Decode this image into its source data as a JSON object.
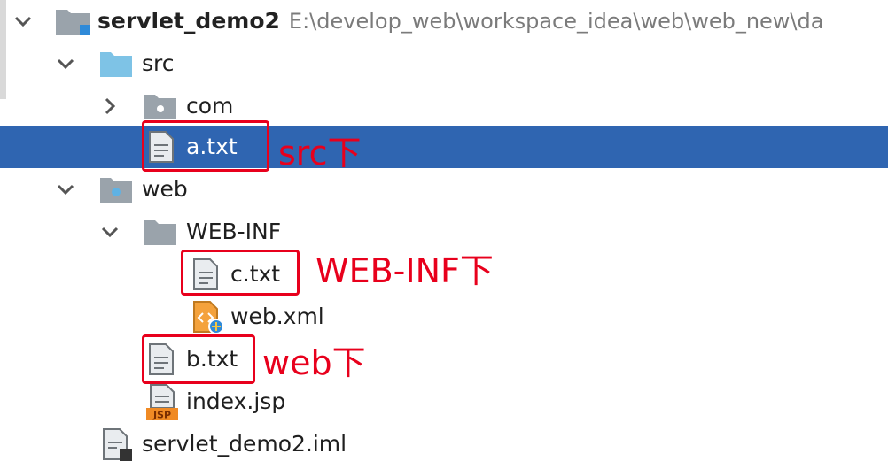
{
  "tree": {
    "root": {
      "name": "servlet_demo2",
      "path": "E:\\develop_web\\workspace_idea\\web\\web_new\\da"
    },
    "items": [
      {
        "label": "src"
      },
      {
        "label": "com"
      },
      {
        "label": "a.txt"
      },
      {
        "label": "web"
      },
      {
        "label": "WEB-INF"
      },
      {
        "label": "c.txt"
      },
      {
        "label": "web.xml"
      },
      {
        "label": "b.txt"
      },
      {
        "label": "index.jsp"
      },
      {
        "label": "servlet_demo2.iml"
      }
    ],
    "jsp_badge": "JSP"
  },
  "annotations": {
    "src": "src下",
    "webinf": "WEB-INF下",
    "web": "web下"
  },
  "colors": {
    "selection": "#2f65b1",
    "annotation": "#e8001c",
    "source_folder": "#7ec3e6",
    "folder": "#9aa3ab"
  }
}
